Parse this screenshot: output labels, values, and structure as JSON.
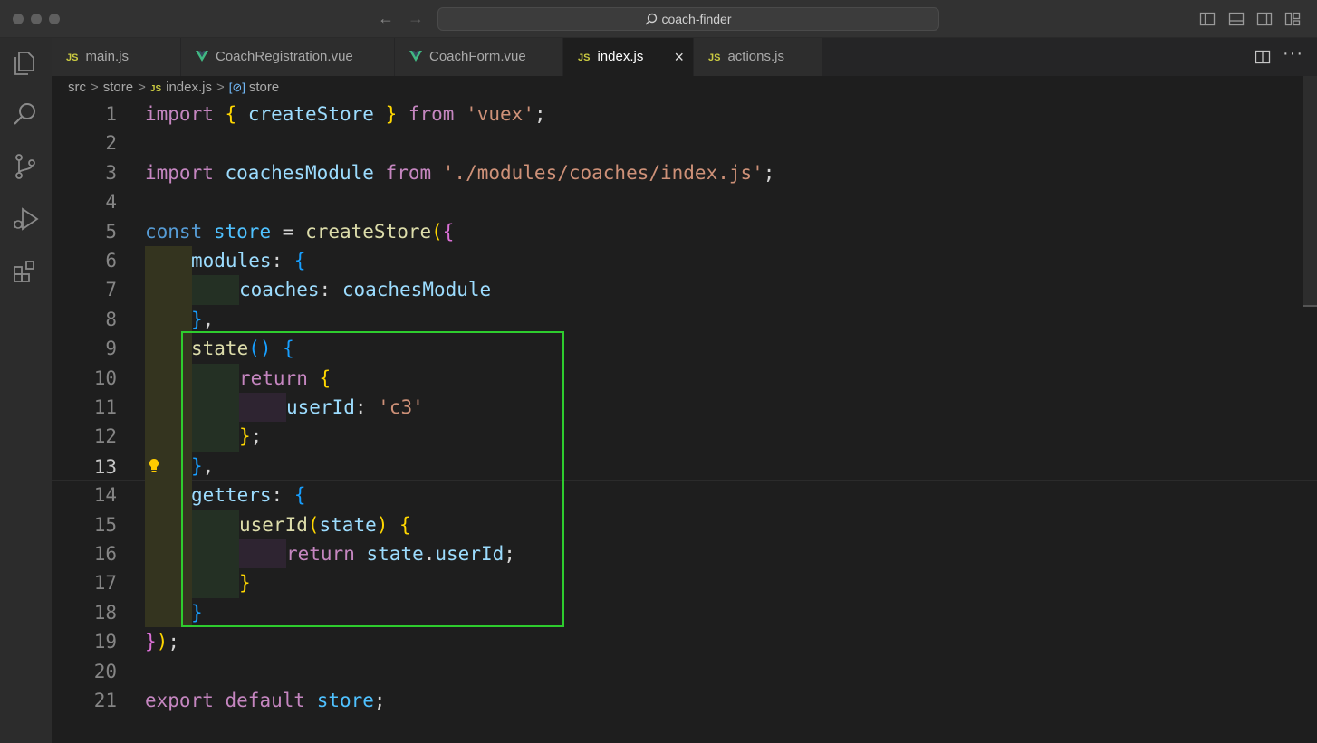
{
  "window": {
    "title": "coach-finder"
  },
  "activity_icons": [
    "files-icon",
    "search-icon",
    "source-control-icon",
    "run-debug-icon",
    "extensions-icon"
  ],
  "tabs": [
    {
      "label": "main.js",
      "kind": "js",
      "badge": "JS"
    },
    {
      "label": "CoachRegistration.vue",
      "kind": "vue"
    },
    {
      "label": "CoachForm.vue",
      "kind": "vue"
    },
    {
      "label": "index.js",
      "kind": "js",
      "badge": "JS",
      "active": true,
      "close": "×"
    },
    {
      "label": "actions.js",
      "kind": "js",
      "badge": "JS"
    }
  ],
  "breadcrumb": {
    "items": [
      "src",
      "store",
      "index.js",
      "store"
    ],
    "js_badge": "JS",
    "separator": ">"
  },
  "editor": {
    "current_line": 13,
    "line_numbers": [
      "1",
      "2",
      "3",
      "4",
      "5",
      "6",
      "7",
      "8",
      "9",
      "10",
      "11",
      "12",
      "13",
      "14",
      "15",
      "16",
      "17",
      "18",
      "19",
      "20",
      "21"
    ],
    "tokens": {
      "import": "import",
      "from": "from",
      "createStore": "createStore",
      "vuex": "'vuex'",
      "coachesModule": "coachesModule",
      "coaches_path": "'./modules/coaches/index.js'",
      "const": "const",
      "store": "store",
      "modules": "modules",
      "coaches": "coaches",
      "state": "state",
      "return": "return",
      "userId": "userId",
      "c3": "'c3'",
      "getters": "getters",
      "export": "export",
      "default": "default"
    }
  },
  "colors": {
    "keyword": "#c586c0",
    "storage": "#569cd6",
    "function": "#dcdcaa",
    "variable": "#9cdcfe",
    "string": "#ce9178",
    "highlight_box": "#2ecc2e"
  }
}
